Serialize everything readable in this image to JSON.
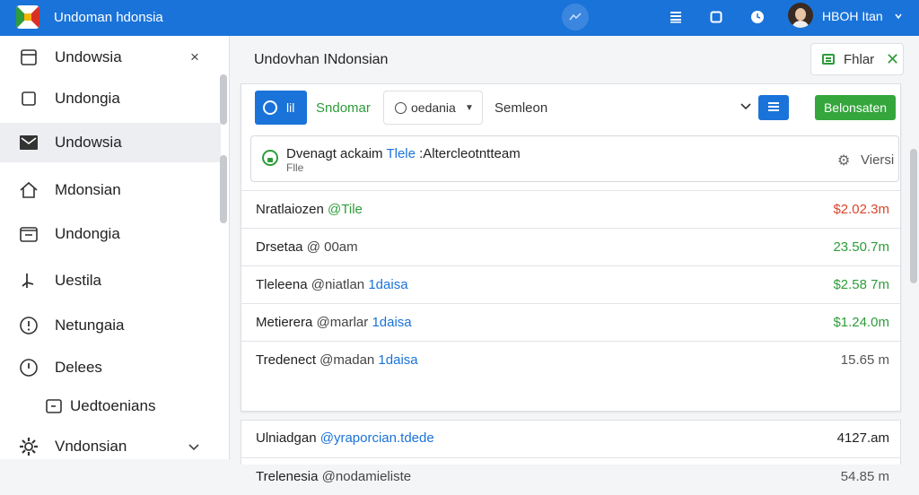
{
  "app": {
    "title": "Undoman hdonsia"
  },
  "topbar": {
    "user_name": "HBOH Itan"
  },
  "sidebar": {
    "items": [
      {
        "label": "Undowsia",
        "icon": "window-icon"
      },
      {
        "label": "Undongia",
        "icon": "square-icon"
      },
      {
        "label": "Undowsia",
        "icon": "mail-icon"
      },
      {
        "label": "Mdonsian",
        "icon": "home-icon"
      },
      {
        "label": "Undongia",
        "icon": "inbox-icon"
      },
      {
        "label": "Uestila",
        "icon": "pin-icon"
      },
      {
        "label": "Netungaia",
        "icon": "info-icon"
      },
      {
        "label": "Delees",
        "icon": "alert-icon"
      },
      {
        "label": "Uedtoenians",
        "icon": "folder-icon"
      },
      {
        "label": "Vndonsian",
        "icon": "settings-icon"
      }
    ]
  },
  "main": {
    "title": "Undovhan INdonsian",
    "filter_label": "Fhlar",
    "toolbar": {
      "primary_label": "lil",
      "link_label": "Sndomar",
      "select_value": "oedania",
      "search_value": "Semleon",
      "action_label": "Belonsaten"
    },
    "notice": {
      "text_before": "Dvenagt ackaim ",
      "tag": "Tlele",
      "text_after": " :Altercleotntteam",
      "subtext": "Flle",
      "action_label": "Viersi"
    },
    "rows": [
      {
        "name": "Nratlaiozen",
        "mention": "@Tile",
        "mention_color": "green",
        "amount": "$2.02.3m",
        "amount_color": "#d9452b"
      },
      {
        "name": "Drsetaa",
        "mention": "@ 00am",
        "mention_color": "gray",
        "amount": "23.50.7m",
        "amount_color": "#2e9c3a"
      },
      {
        "name": "Tleleena",
        "mention": "@niatlan ",
        "mention_highlight": "1daisa",
        "amount": "$2.58 7m",
        "amount_color": "#2e9c3a"
      },
      {
        "name": "Metierera",
        "mention": "@marlar ",
        "mention_highlight": "1daisa",
        "amount": "$1.24.0m",
        "amount_color": "#2e9c3a"
      },
      {
        "name": "Tredenect",
        "mention": "@madan ",
        "mention_highlight": "1daisa",
        "amount": "15.65 m",
        "amount_color": "#555555"
      }
    ],
    "rows2": [
      {
        "name": "Ulniadgan",
        "mention": "@yraporcian.tdede",
        "mention_color": "blue",
        "amount": "4127.am",
        "amount_color": "#222222"
      },
      {
        "name": "Trelenesia",
        "mention": "@nodamieliste",
        "mention_color": "gray",
        "amount": "54.85 m",
        "amount_color": "#555555"
      }
    ]
  },
  "colors": {
    "accent": "#1a73d9",
    "success": "#34a63b",
    "danger": "#d9452b"
  }
}
